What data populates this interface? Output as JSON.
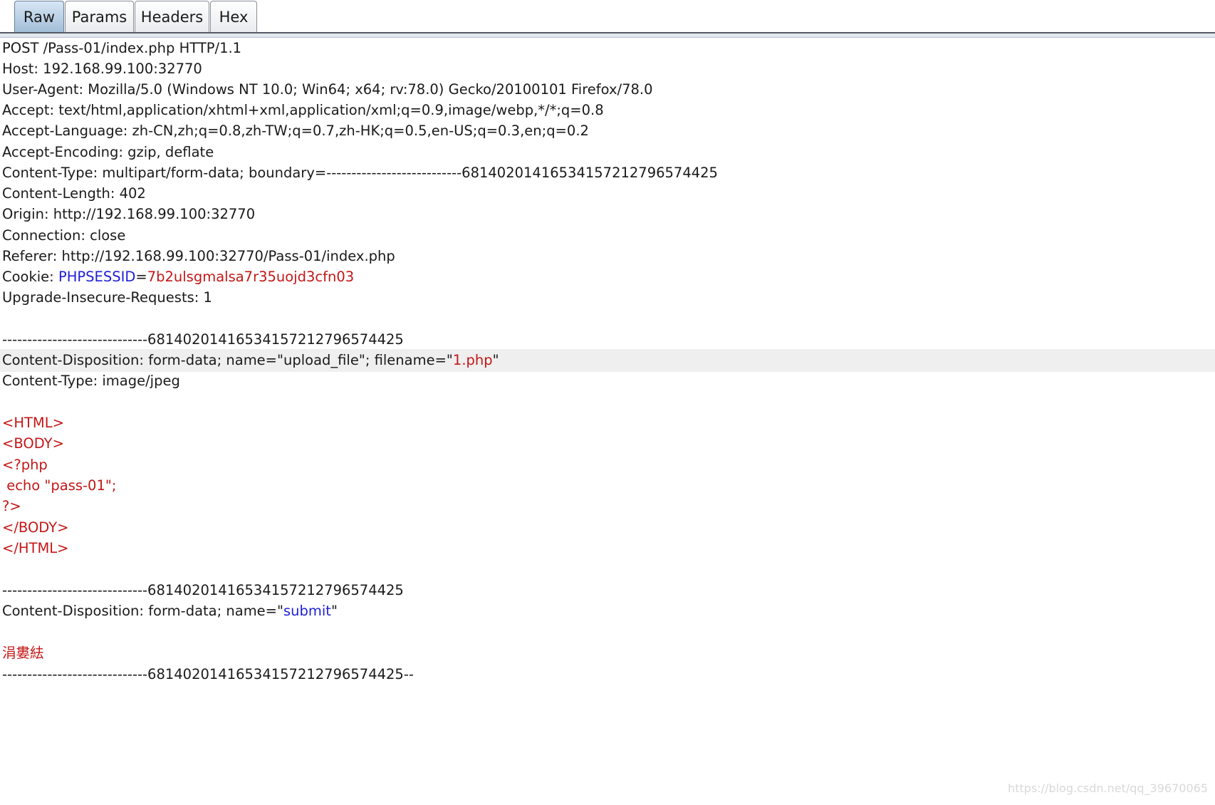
{
  "tabs": [
    {
      "label": "Raw",
      "active": true
    },
    {
      "label": "Params",
      "active": false
    },
    {
      "label": "Headers",
      "active": false
    },
    {
      "label": "Hex",
      "active": false
    }
  ],
  "colors": {
    "text": "#1a1a1a",
    "key_blue": "#1f1fd6",
    "value_red": "#c41717",
    "highlight_row": "#efefef",
    "active_tab": "#9fbcd6"
  },
  "request": {
    "request_line": "POST /Pass-01/index.php HTTP/1.1",
    "host": "Host: 192.168.99.100:32770",
    "user_agent": "User-Agent: Mozilla/5.0 (Windows NT 10.0; Win64; x64; rv:78.0) Gecko/20100101 Firefox/78.0",
    "accept": "Accept: text/html,application/xhtml+xml,application/xml;q=0.9,image/webp,*/*;q=0.8",
    "accept_language": "Accept-Language: zh-CN,zh;q=0.8,zh-TW;q=0.7,zh-HK;q=0.5,en-US;q=0.3,en;q=0.2",
    "accept_encoding": "Accept-Encoding: gzip, deflate",
    "content_type": "Content-Type: multipart/form-data; boundary=---------------------------6814020141653415721279657442­5",
    "content_length": "Content-Length: 402",
    "origin": "Origin: http://192.168.99.100:32770",
    "connection": "Connection: close",
    "referer": "Referer: http://192.168.99.100:32770/Pass-01/index.php",
    "cookie_prefix": "Cookie: ",
    "cookie_name": "PHPSESSID",
    "cookie_eq": "=",
    "cookie_value": "7b2ulsgmalsa7r35uojd3cfn03",
    "upgrade": "Upgrade-Insecure-Requests: 1"
  },
  "body": {
    "boundary1": "-----------------------------68140201416534157212796574425",
    "disp1_prefix": "Content-Disposition: form-data; name=\"upload_file\"; filename=\"",
    "disp1_filename": "1.php",
    "disp1_suffix": "\"",
    "part_content_type": "Content-Type: image/jpeg",
    "php_lines": [
      "<HTML>",
      "<BODY>",
      "<?php",
      " echo \"pass-01\";",
      "?>",
      "</BODY>",
      "</HTML>"
    ],
    "boundary2": "-----------------------------68140201416534157212796574425",
    "disp2_prefix": "Content-Disposition: form-data; name=\"",
    "disp2_name": "submit",
    "disp2_suffix": "\"",
    "submit_value": "涓婁紶",
    "boundary_end": "-----------------------------68140201416534157212796574425--"
  },
  "watermark": "https://blog.csdn.net/qq_39670065"
}
